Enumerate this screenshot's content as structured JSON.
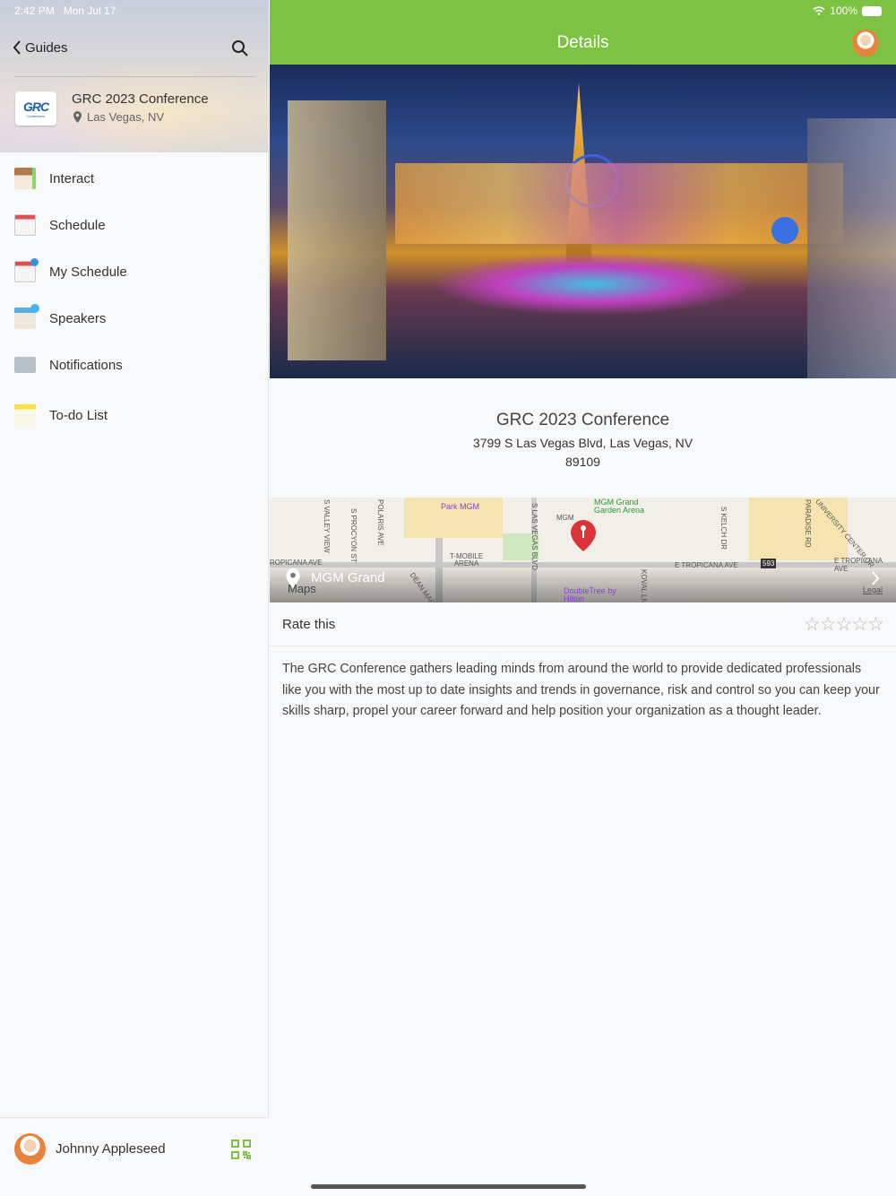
{
  "status": {
    "time": "2:42 PM",
    "date": "Mon Jul 17",
    "battery": "100%"
  },
  "sidebar": {
    "back_label": "Guides",
    "guide": {
      "title": "GRC 2023 Conference",
      "location": "Las Vegas, NV",
      "logo_text": "GRC Conference"
    },
    "items": [
      {
        "label": "Interact",
        "icon": "interact-icon"
      },
      {
        "label": "Schedule",
        "icon": "calendar-icon"
      },
      {
        "label": "My Schedule",
        "icon": "my-schedule-icon"
      },
      {
        "label": "Speakers",
        "icon": "speakers-icon"
      },
      {
        "label": "Notifications",
        "icon": "envelope-icon"
      },
      {
        "label": "To-do List",
        "icon": "todo-icon"
      }
    ],
    "user": {
      "name": "Johnny Appleseed"
    }
  },
  "header": {
    "title": "Details"
  },
  "event": {
    "title": "GRC 2023 Conference",
    "address_line1": "3799 S Las Vegas Blvd, Las Vegas, NV",
    "address_line2": "89109"
  },
  "map": {
    "place": "MGM Grand",
    "attribution": "Maps",
    "legal": "Legal",
    "labels": [
      "Park MGM",
      "MGM Grand Garden Arena",
      "T-MOBILE ARENA",
      "S LAS VEGAS BLVD",
      "E TROPICANA AVE",
      "E TROPICANA AVE",
      "ROPICANA AVE",
      "DoubleTree by Hilton",
      "MGM",
      "S VALLEY VIEW",
      "S PROCYON ST",
      "POLARIS AVE",
      "KOVAL LN",
      "PARADISE RD",
      "S KELCH DR",
      "UNIVERSITY CENTER DR",
      "DEAN MARTIN DR",
      "593"
    ]
  },
  "rating": {
    "label": "Rate this",
    "value": 0,
    "max": 5
  },
  "description": "The GRC Conference gathers leading minds from around the world to provide dedicated professionals like you with the most up to date insights and trends in governance, risk and control so you can keep your skills sharp, propel your career forward and help position your organization as a thought leader.",
  "colors": {
    "accent": "#7dc242",
    "pin": "#d9343a"
  }
}
